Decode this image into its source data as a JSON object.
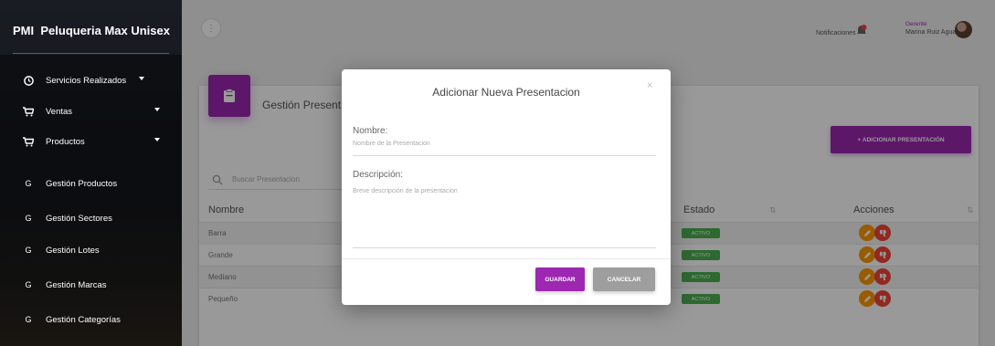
{
  "brand": {
    "abbr": "PMI",
    "name": "Peluqueria Max Unisex"
  },
  "sidebar": {
    "items": [
      {
        "icon": "clock-icon",
        "label": "Servicios Realizados",
        "caret": true
      },
      {
        "icon": "cart-icon",
        "label": "Ventas",
        "caret": true
      },
      {
        "icon": "cart-icon",
        "label": "Productos",
        "caret": true
      },
      {
        "icon": "letter-g",
        "letter": "G",
        "label": "Gestión Productos"
      },
      {
        "icon": "letter-g",
        "letter": "G",
        "label": "Gestión Sectores"
      },
      {
        "icon": "letter-g",
        "letter": "G",
        "label": "Gestión Lotes"
      },
      {
        "icon": "letter-g",
        "letter": "G",
        "label": "Gestión Marcas"
      },
      {
        "icon": "letter-g",
        "letter": "G",
        "label": "Gestión Categorías"
      }
    ]
  },
  "topbar": {
    "toggle": "⋮",
    "notifications_label": "Notificaciones",
    "user_role": "Gerente",
    "user_name": "Marina Ruiz Aguayo"
  },
  "card": {
    "title": "Gestión Presentaciones",
    "add_button": "+ ADICIONAR PRESENTACIÓN",
    "search_placeholder": "Buscar Presentacion",
    "columns": [
      "Nombre",
      "Estado",
      "Acciones"
    ],
    "rows": [
      {
        "name": "Barra",
        "status": "ACTIVO"
      },
      {
        "name": "Grande",
        "status": "ACTIVO"
      },
      {
        "name": "Mediano",
        "status": "ACTIVO"
      },
      {
        "name": "Pequeño",
        "status": "ACTIVO"
      }
    ]
  },
  "modal": {
    "title": "Adicionar Nueva Presentacion",
    "close": "×",
    "name_label": "Nombre:",
    "name_placeholder": "Nombre de la Presentacion",
    "desc_label": "Descripción:",
    "desc_placeholder": "Breve descripción de la presentacion",
    "save": "GUARDAR",
    "cancel": "CANCELAR"
  },
  "colors": {
    "accent": "#9c27b0",
    "active": "#4caf50",
    "edit": "#ff9800",
    "delete": "#f44336",
    "cancel": "#9e9e9e"
  }
}
